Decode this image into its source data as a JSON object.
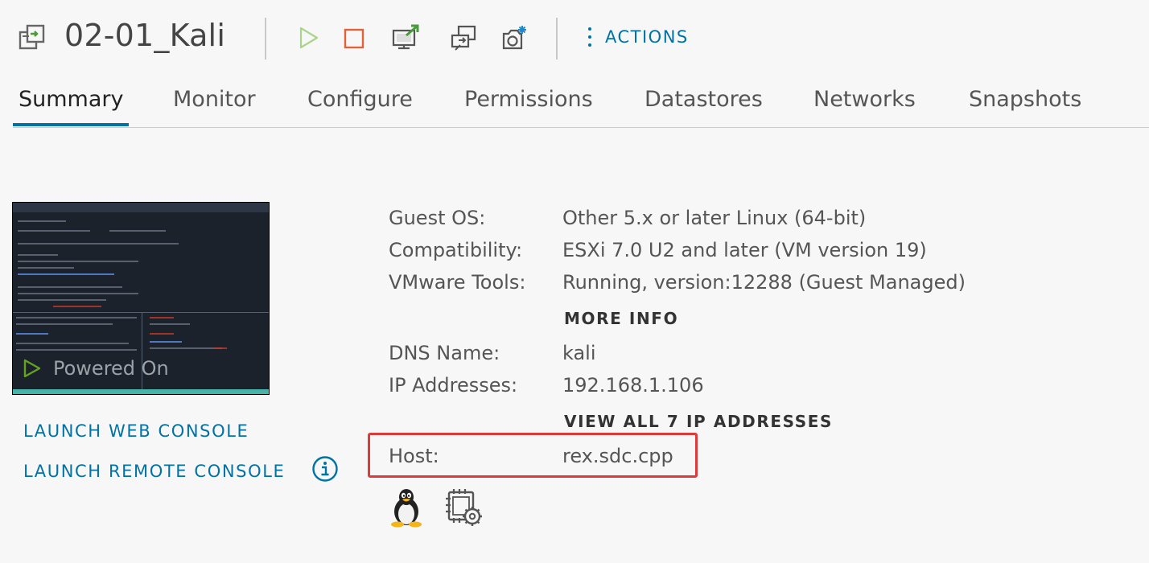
{
  "header": {
    "title": "02-01_Kali",
    "actions_label": "ACTIONS",
    "toolbar_icons": [
      "vm-icon",
      "power-on-icon",
      "power-off-icon",
      "launch-console-icon",
      "migrate-icon",
      "snapshot-icon"
    ]
  },
  "tabs": [
    {
      "label": "Summary",
      "active": true
    },
    {
      "label": "Monitor",
      "active": false
    },
    {
      "label": "Configure",
      "active": false
    },
    {
      "label": "Permissions",
      "active": false
    },
    {
      "label": "Datastores",
      "active": false
    },
    {
      "label": "Networks",
      "active": false
    },
    {
      "label": "Snapshots",
      "active": false
    }
  ],
  "console": {
    "power_state": "Powered On",
    "launch_web": "LAUNCH WEB CONSOLE",
    "launch_remote": "LAUNCH REMOTE CONSOLE"
  },
  "summary": {
    "guest_os_label": "Guest OS:",
    "guest_os_value": "Other 5.x or later Linux (64-bit)",
    "compat_label": "Compatibility:",
    "compat_value": "ESXi 7.0 U2 and later (VM version 19)",
    "tools_label": "VMware Tools:",
    "tools_value": "Running, version:12288 (Guest Managed)",
    "more_info": "MORE INFO",
    "dns_label": "DNS Name:",
    "dns_value": "kali",
    "ip_label": "IP Addresses:",
    "ip_value": "192.168.1.106",
    "view_all_ip": "VIEW ALL 7 IP ADDRESSES",
    "host_label": "Host:",
    "host_value": "rex.sdc.cpp"
  },
  "colors": {
    "accent": "#0072a3",
    "highlight": "#dd3a3a",
    "power_on": "#62a420",
    "power_off": "#e0623a"
  }
}
